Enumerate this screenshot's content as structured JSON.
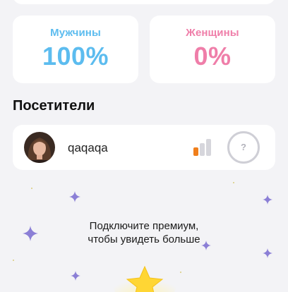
{
  "stats": {
    "male_label": "Мужчины",
    "male_value": "100%",
    "female_label": "Женщины",
    "female_value": "0%"
  },
  "visitors": {
    "title": "Посетители",
    "items": [
      {
        "name": "qaqaqa",
        "badge": "?"
      }
    ]
  },
  "premium": {
    "line1": "Подключите премиум,",
    "line2": "чтобы увидеть больше"
  },
  "colors": {
    "male": "#5cbcef",
    "female": "#ef7ea9",
    "signal_active": "#f07f1c",
    "sparkle": "#8b7fd6",
    "star": "#ffd634"
  }
}
